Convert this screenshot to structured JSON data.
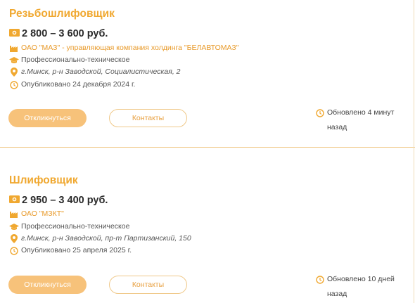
{
  "jobs": [
    {
      "title": "Резьбошлифовщик",
      "salary": "2 800 – 3 600 руб.",
      "company": "ОАО \"МАЗ\" - управляющая компания холдинга \"БЕЛАВТОМАЗ\"",
      "education": "Профессионально-техническое",
      "address": "г.Минск, р-н Заводской, Социалистическая, 2",
      "published": "Опубликовано 24 декабря 2024 г.",
      "apply_label": "Откликнуться",
      "contacts_label": "Контакты",
      "updated": "Обновлено 4 минут назад"
    },
    {
      "title": "Шлифовщик",
      "salary": "2 950 – 3 400 руб.",
      "company": "ОАО \"МЗКТ\"",
      "education": "Профессионально-техническое",
      "address": "г.Минск, р-н Заводской, пр-т Партизанский, 150",
      "published": "Опубликовано 25 апреля 2025 г.",
      "apply_label": "Откликнуться",
      "contacts_label": "Контакты",
      "updated": "Обновлено 10 дней назад"
    }
  ],
  "colors": {
    "accent": "#f0a830",
    "button_fill": "#f7c27a",
    "divider": "#f0c98a"
  },
  "icons": [
    "money-icon",
    "factory-icon",
    "graduation-cap-icon",
    "location-pin-icon",
    "clock-icon"
  ]
}
